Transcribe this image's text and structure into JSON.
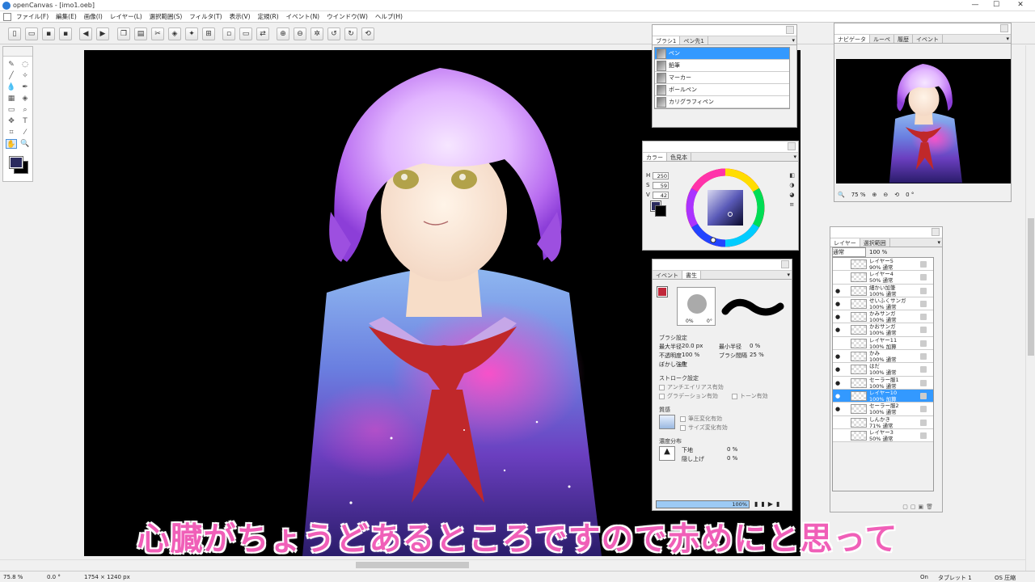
{
  "window": {
    "title": "openCanvas - [imo1.oeb]",
    "minimize": "—",
    "maximize": "☐",
    "close": "✕"
  },
  "menu": [
    "ファイル(F)",
    "編集(E)",
    "画像(I)",
    "レイヤー(L)",
    "選択範囲(S)",
    "フィルタ(T)",
    "表示(V)",
    "定規(R)",
    "イベント(N)",
    "ウインドウ(W)",
    "ヘルプ(H)"
  ],
  "toolbar_icons": [
    "new-icon",
    "open-icon",
    "save-icon",
    "save-as-icon",
    "prev-icon",
    "next-icon",
    "copy-icon",
    "paste-icon",
    "cut-icon",
    "fill-icon",
    "transform-icon",
    "select-all-icon",
    "deselect-icon",
    "crop-icon",
    "invert-icon",
    "zoom-in-icon",
    "zoom-out-icon",
    "fit-icon",
    "rotate-left-icon",
    "rotate-right-icon",
    "reset-rotation-icon"
  ],
  "caption": "心臓がちょうどあるところですので赤めにと思って",
  "brush_panel": {
    "tabs": [
      "ブラシ1",
      "ペン先1"
    ],
    "items": [
      {
        "label": "ペン",
        "selected": true
      },
      {
        "label": "鉛筆",
        "selected": false
      },
      {
        "label": "マーカー",
        "selected": false
      },
      {
        "label": "ボールペン",
        "selected": false
      },
      {
        "label": "カリグラフィペン",
        "selected": false
      }
    ]
  },
  "color_panel": {
    "tabs": [
      "カラー",
      "色見本"
    ],
    "h_label": "H",
    "h_value": "250",
    "s_label": "S",
    "s_value": "59",
    "v_label": "V",
    "v_value": "42",
    "current_color": "#2a2a5e"
  },
  "tool_settings": {
    "tabs": [
      "イベント",
      "書生"
    ],
    "min_pct": "0%",
    "max_pct": "0°",
    "brush_header": "ブラシ設定",
    "max_radius_label": "最大半径",
    "max_radius_value": "20.0 px",
    "min_radius_label": "最小半径",
    "min_radius_value": "0 %",
    "opacity_label": "不透明度",
    "opacity_value": "100 %",
    "interval_label": "ブラシ間隔",
    "interval_value": "25 %",
    "blur_label": "ぼかし強度",
    "blur_value": "0",
    "stroke_header": "ストローク設定",
    "antialias": "アンチエイリアス有効",
    "gradation": "グラデーション有効",
    "tone": "トーン有効",
    "texture_header": "質感",
    "tex_opt1": "筆圧変化有効",
    "tex_opt2": "サイズ変化有効",
    "density_header": "濃度分布",
    "density_a_label": "下地",
    "density_a_value": "0 %",
    "density_b_label": "隠し上げ",
    "density_b_value": "0 %",
    "progress_label": "100%"
  },
  "navigator": {
    "tabs": [
      "ナビゲータ",
      "ルーペ",
      "履歴",
      "イベント"
    ],
    "zoom": "75 %",
    "rotation": "0 °"
  },
  "layers_panel": {
    "tabs": [
      "レイヤー",
      "選択範囲"
    ],
    "blend_mode": "通常",
    "opacity": "100 %",
    "layers": [
      {
        "name": "レイヤー5",
        "info": "90% 通常",
        "visible": false,
        "selected": false
      },
      {
        "name": "レイヤー4",
        "info": "50% 通常",
        "visible": false,
        "selected": false
      },
      {
        "name": "細かい加筆",
        "info": "100% 通常",
        "visible": true,
        "selected": false
      },
      {
        "name": "せいふくサンガ",
        "info": "100% 通常",
        "visible": true,
        "selected": false
      },
      {
        "name": "かみサンガ",
        "info": "100% 通常",
        "visible": true,
        "selected": false
      },
      {
        "name": "かおサンガ",
        "info": "100% 通常",
        "visible": true,
        "selected": false
      },
      {
        "name": "レイヤー11",
        "info": "100% 加算",
        "visible": false,
        "selected": false
      },
      {
        "name": "かみ",
        "info": "100% 通常",
        "visible": true,
        "selected": false
      },
      {
        "name": "はだ",
        "info": "100% 通常",
        "visible": true,
        "selected": false
      },
      {
        "name": "セーラー服1",
        "info": "100% 通常",
        "visible": true,
        "selected": false
      },
      {
        "name": "レイヤー10",
        "info": "100% 加算",
        "visible": true,
        "selected": true
      },
      {
        "name": "セーラー服2",
        "info": "100% 通常",
        "visible": true,
        "selected": false
      },
      {
        "name": "しんかき",
        "info": "71% 通常",
        "visible": false,
        "selected": false
      },
      {
        "name": "レイヤー3",
        "info": "50% 通常",
        "visible": false,
        "selected": false
      }
    ]
  },
  "status": {
    "zoom": "75.8 %",
    "angle": "0.0 °",
    "size": "1754 × 1240 px",
    "mode": "On",
    "device": "タブレット 1",
    "right": "OS 圧縮"
  }
}
